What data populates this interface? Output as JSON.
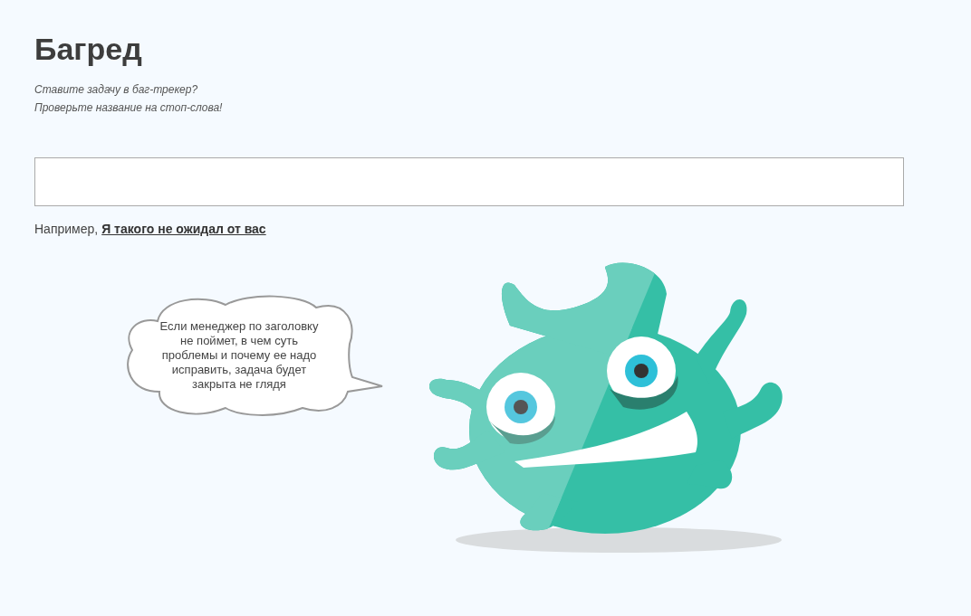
{
  "title": "Багред",
  "subtitle_lines": [
    "Ставите задачу в баг-трекер?",
    "Проверьте название на стоп-слова!"
  ],
  "example": {
    "prefix": "Например,",
    "link": "Я такого не ожидал от вас"
  },
  "speech_bubble": {
    "text": "Если менеджер по заголовку не поймет, в чем суть проблемы и почему ее надо исправить, задача будет закрыта не глядя"
  }
}
